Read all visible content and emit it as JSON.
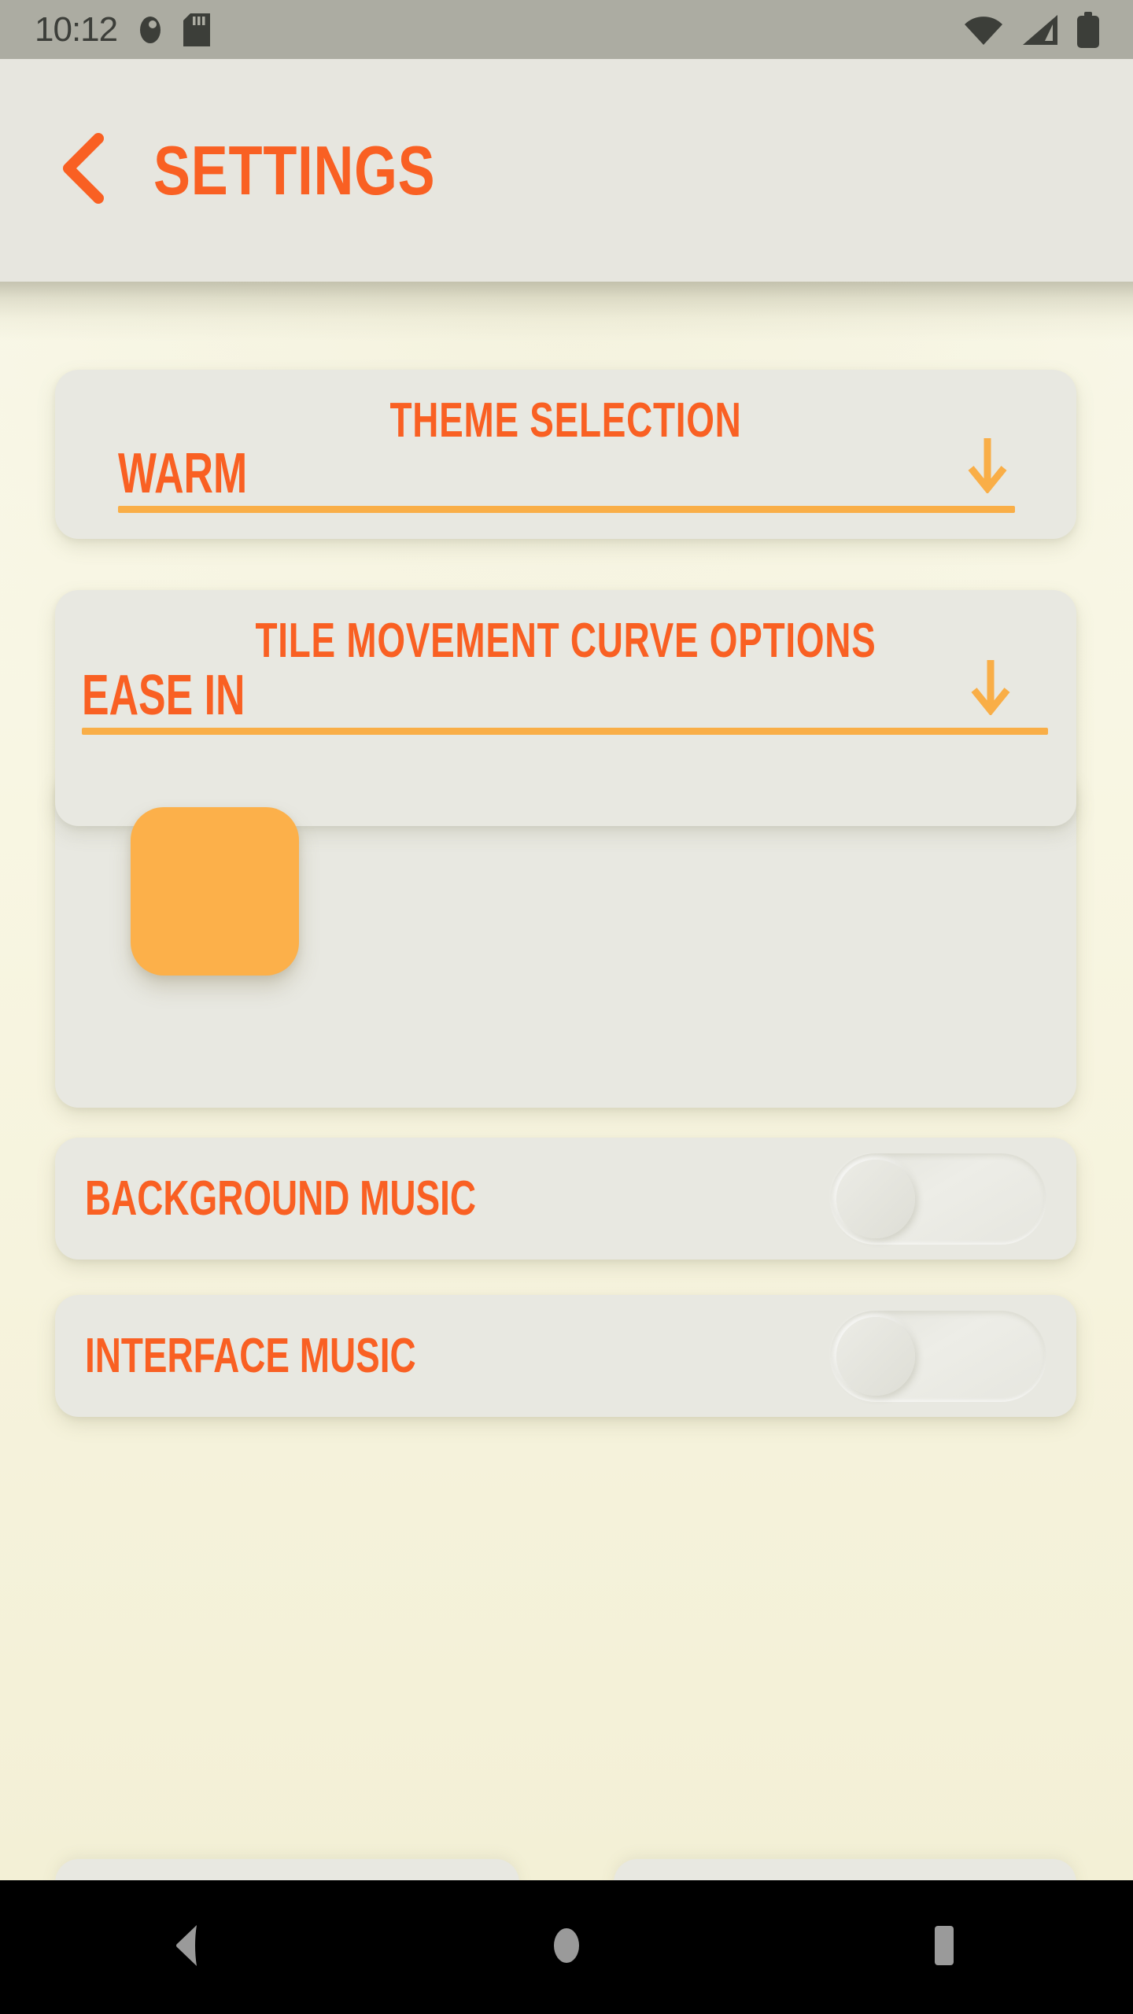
{
  "status_bar": {
    "time": "10:12",
    "left_icons": [
      "do-not-disturb-icon",
      "sd-card-icon"
    ],
    "right_icons": [
      "wifi-icon",
      "cellular-signal-icon",
      "battery-icon"
    ],
    "background_color": "#ACACA2",
    "icon_color": "#3C3E39"
  },
  "header": {
    "back_icon": "chevron-left-icon",
    "title": "SETTINGS",
    "background_color": "#E7E6DF",
    "accent_color": "#F96023"
  },
  "theme": {
    "accent_orange": "#F96023",
    "accent_amber": "#F9AE47",
    "tile_color": "#FCB04A",
    "card_color": "#E8E8E1",
    "page_background": "#FAF8E8"
  },
  "cards": {
    "theme_selection": {
      "title": "THEME SELECTION",
      "dropdown_value": "WARM",
      "dropdown_icon": "arrow-down-icon"
    },
    "tile_movement": {
      "title": "TILE MOVEMENT CURVE OPTIONS",
      "dropdown_value": "EASE IN",
      "dropdown_icon": "arrow-down-icon",
      "preview_label": "tile-preview"
    },
    "background_music": {
      "label": "BACKGROUND MUSIC",
      "toggle_state": "off"
    },
    "interface_music": {
      "label": "INTERFACE MUSIC",
      "toggle_state": "off"
    }
  },
  "nav_bar": {
    "background_color": "#000000",
    "glyph_color": "#9A9A9A",
    "buttons": [
      "back-triangle-icon",
      "home-circle-icon",
      "recents-square-icon"
    ]
  }
}
